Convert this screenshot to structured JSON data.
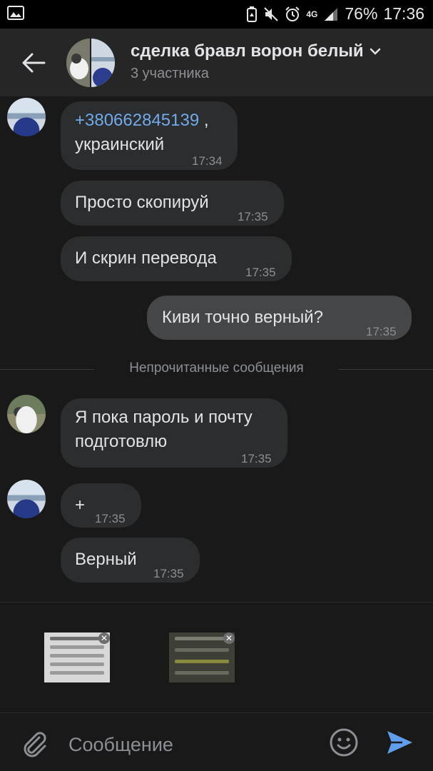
{
  "status_bar": {
    "network": "4G",
    "battery": "76%",
    "time": "17:36"
  },
  "header": {
    "title": "сделка бравл ворон белый",
    "subtitle": "3 участника"
  },
  "messages": [
    {
      "link": "+380662845139",
      "text_after_link": " ,",
      "line2": "украинский",
      "time": "17:34"
    },
    {
      "text": "Просто скопируй",
      "time": "17:35"
    },
    {
      "text": "И скрин перевода",
      "time": "17:35"
    },
    {
      "text": "Киви точно верный?",
      "time": "17:35"
    },
    {
      "text1": "Я пока пароль и почту",
      "text2": "подготовлю",
      "time": "17:35"
    },
    {
      "text": "+",
      "time": "17:35"
    },
    {
      "text": "Верный",
      "time": "17:35"
    }
  ],
  "unread_label": "Непрочитанные сообщения",
  "composer": {
    "placeholder": "Сообщение"
  },
  "colors": {
    "background": "#19191a",
    "header": "#262626",
    "bubble_in": "#2c2d2e",
    "bubble_out": "#454647",
    "link": "#71aaeb",
    "send": "#5f9eec"
  },
  "icons": [
    "gallery-icon",
    "battery-saver-icon",
    "mute-icon",
    "alarm-icon",
    "signal-icon",
    "back-arrow-icon",
    "chevron-down-icon",
    "paperclip-icon",
    "emoji-icon",
    "send-icon",
    "close-icon"
  ]
}
